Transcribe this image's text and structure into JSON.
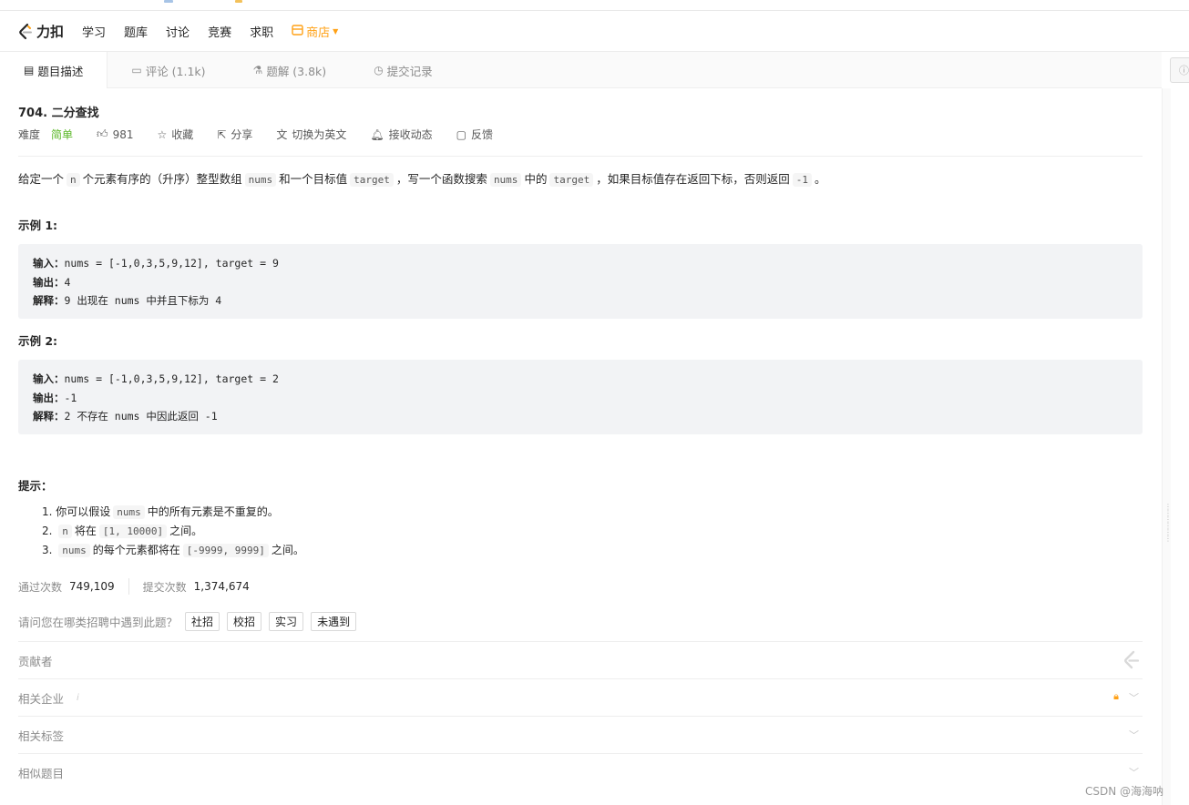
{
  "colors": {
    "accent": "#ffa116",
    "easy": "#5ab726"
  },
  "nav": {
    "logo_text": "力扣",
    "items": [
      "学习",
      "题库",
      "讨论",
      "竞赛",
      "求职"
    ],
    "store_label": "商店"
  },
  "tabs": [
    {
      "label": "题目描述",
      "icon": "description-icon"
    },
    {
      "label": "评论 (1.1k)",
      "icon": "comment-icon"
    },
    {
      "label": "题解 (3.8k)",
      "icon": "flask-icon"
    },
    {
      "label": "提交记录",
      "icon": "history-clock-icon"
    }
  ],
  "problem": {
    "title": "704. 二分查找",
    "difficulty_label": "难度",
    "difficulty_value": "简单",
    "likes": "981",
    "favorite_label": "收藏",
    "share_label": "分享",
    "switch_lang_label": "切换为英文",
    "subscribe_label": "接收动态",
    "feedback_label": "反馈",
    "desc": {
      "p1": "给定一个",
      "c1": "n",
      "p2": "个元素有序的（升序）整型数组",
      "c2": "nums",
      "p3": "和一个目标值",
      "c3": "target",
      "p4": "，写一个函数搜索",
      "c4": "nums",
      "p5": "中的",
      "c5": "target",
      "p6": "，如果目标值存在返回下标，否则返回",
      "c6": "-1",
      "p7": "。"
    }
  },
  "examples": [
    {
      "title": "示例 1:",
      "input_label": "输入：",
      "input": "nums = [-1,0,3,5,9,12], target = 9",
      "output_label": "输出：",
      "output": "4",
      "explain_label": "解释：",
      "explain": "9 出现在 nums 中并且下标为 4"
    },
    {
      "title": "示例 2:",
      "input_label": "输入：",
      "input": "nums = [-1,0,3,5,9,12], target = 2",
      "output_label": "输出：",
      "output": "-1",
      "explain_label": "解释：",
      "explain": "2 不存在 nums 中因此返回 -1"
    }
  ],
  "tips": {
    "title": "提示：",
    "items": [
      {
        "num": "1.",
        "pre": "你可以假设",
        "code": "nums",
        "post": "中的所有元素是不重复的。"
      },
      {
        "num": "2.",
        "pre": "",
        "code": "n",
        "mid": "将在",
        "code2": "[1, 10000]",
        "post": "之间。"
      },
      {
        "num": "3.",
        "pre": "",
        "code": "nums",
        "mid": "的每个元素都将在",
        "code2": "[-9999, 9999]",
        "post": "之间。"
      }
    ]
  },
  "stats": {
    "accepted_label": "通过次数",
    "accepted_value": "749,109",
    "submissions_label": "提交次数",
    "submissions_value": "1,374,674"
  },
  "ask": {
    "question": "请问您在哪类招聘中遇到此题？",
    "options": [
      "社招",
      "校招",
      "实习",
      "未遇到"
    ]
  },
  "sections": {
    "contributors": "贡献者",
    "companies": "相关企业",
    "tags": "相关标签",
    "similar": "相似题目"
  },
  "watermark": "CSDN @海海呐"
}
